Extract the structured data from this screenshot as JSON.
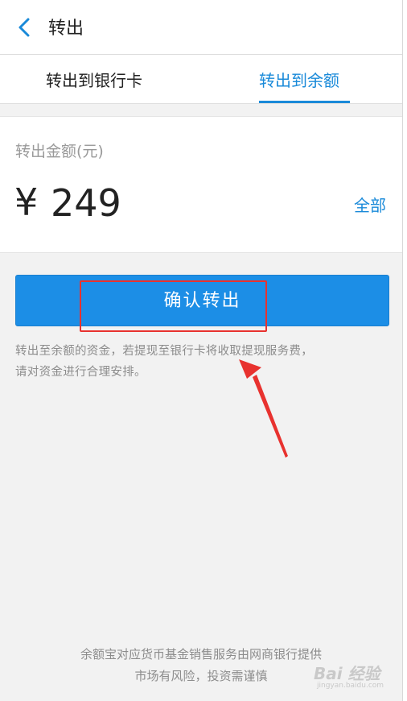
{
  "header": {
    "title": "转出"
  },
  "tabs": [
    {
      "label": "转出到银行卡",
      "selected": false
    },
    {
      "label": "转出到余额",
      "selected": true
    }
  ],
  "amount": {
    "label": "转出金额(元)",
    "currency": "¥",
    "value": "249",
    "all_label": "全部"
  },
  "confirm": {
    "label": "确认转出"
  },
  "notice": {
    "line1": "转出至余额的资金，若提现至银行卡将收取提现服务费，",
    "line2": "请对资金进行合理安排。"
  },
  "footer": {
    "line1": "余额宝对应货币基金销售服务由网商银行提供",
    "line2": "市场有风险，投资需谨慎"
  },
  "watermark": {
    "main": "Bai 经验",
    "sub": "jingyan.baidu.com"
  },
  "colors": {
    "accent": "#1a8ad9",
    "button": "#1c8ee6",
    "annotation": "#e8322f"
  },
  "icons": {
    "back": "chevron-left-icon",
    "arrow": "annotation-arrow-icon"
  }
}
